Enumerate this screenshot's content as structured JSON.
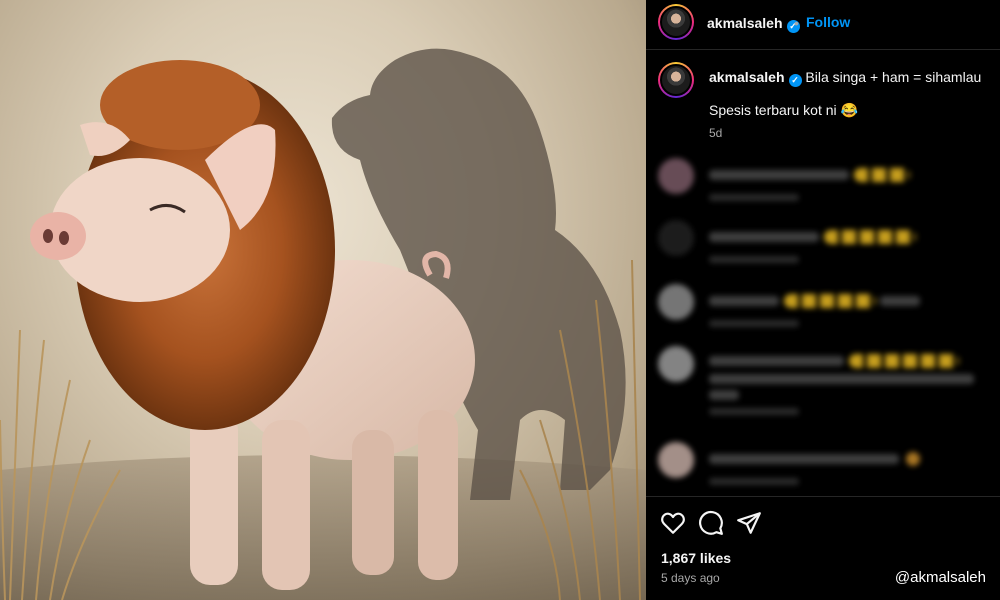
{
  "post": {
    "username": "akmalsaleh",
    "verified_icon": "verified-badge-icon",
    "separator": "•",
    "follow_label": "Follow",
    "caption_line1": "Bila singa + ham = sihamlau",
    "caption_line2": "Spesis terbaru kot ni 😂",
    "caption_age": "5d",
    "likes": "1,867 likes",
    "posted_ago": "5 days ago",
    "watermark": "@akmalsaleh"
  },
  "media": {
    "description_icon": "post-image"
  },
  "actions": {
    "like_icon": "heart-icon",
    "comment_icon": "comment-icon",
    "share_icon": "share-icon"
  },
  "colors": {
    "background": "#000000",
    "accent": "#0095f6",
    "muted": "#a8a8a8"
  }
}
